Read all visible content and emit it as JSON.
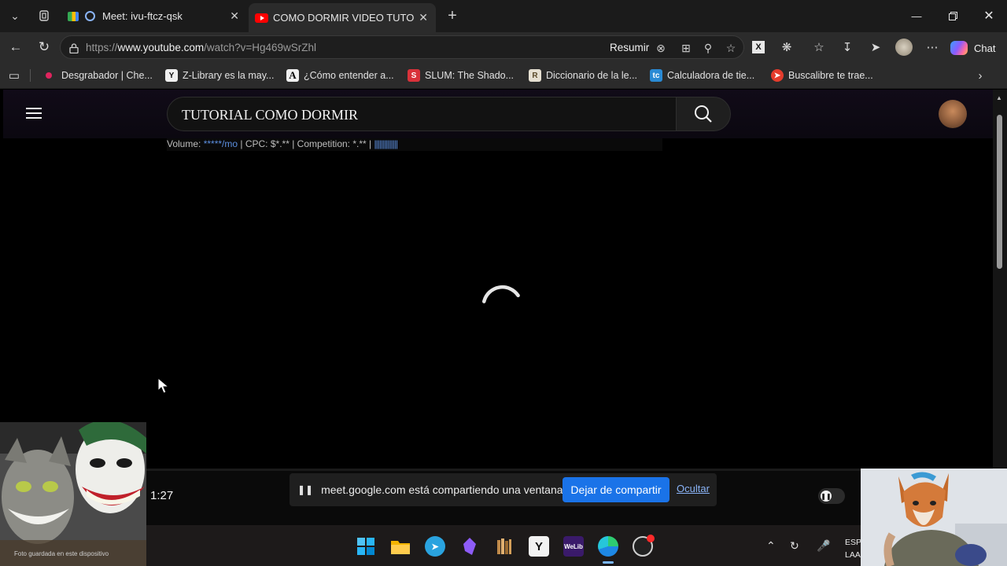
{
  "browser": {
    "tabs": [
      {
        "label": "Meet: ivu-ftcz-qsk",
        "active": false
      },
      {
        "label": "COMO DORMIR VIDEO TUTORIAL",
        "active": true
      }
    ],
    "url_prefix": "https://",
    "url_host": "www.youtube.com",
    "url_path": "/watch?v=Hg469wSrZhl",
    "summarize_label": "Resumir",
    "chat_label": "Chat"
  },
  "bookmarks": [
    {
      "label": "Desgrabador | Che...",
      "icon": "red-dot-icon"
    },
    {
      "label": "Z-Library es la may...",
      "icon": "zlibrary-icon"
    },
    {
      "label": "¿Cómo entender a...",
      "icon": "a-logo-icon"
    },
    {
      "label": "SLUM: The Shado...",
      "icon": "slum-icon"
    },
    {
      "label": "Diccionario de la le...",
      "icon": "dictionary-icon"
    },
    {
      "label": "Calculadora de tie...",
      "icon": "calculator-icon"
    },
    {
      "label": "Buscalibre te trae...",
      "icon": "buscalibre-icon"
    }
  ],
  "youtube": {
    "search_query": "TUTORIAL COMO DORMIR",
    "keyword_prefix": "Volume: ",
    "keyword_volume": "*****/mo",
    "keyword_rest": " | CPC: $*.** | Competition: *.** | ",
    "keyword_bars": "||||||||||||||"
  },
  "player": {
    "time": "1:27"
  },
  "share_notice": {
    "message": "meet.google.com está compartiendo una ventana.",
    "stop_label": "Dejar de compartir",
    "hide_label": "Ocultar"
  },
  "taskbar": {
    "welib_label": "WeLib",
    "lang_top": "ESP",
    "lang_bottom": "LAA"
  },
  "webcam": {
    "caption": "Foto guardada en este dispositivo"
  },
  "colors": {
    "accent_blue": "#1a73e8",
    "link_blue": "#8ab4f8",
    "youtube_red": "#ff0000"
  }
}
